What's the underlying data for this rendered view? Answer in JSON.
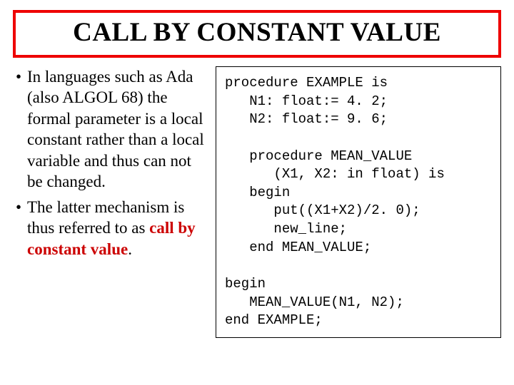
{
  "title": "CALL BY CONSTANT VALUE",
  "bullets": [
    {
      "pre": "In languages such as Ada (also ALGOL 68) the formal parameter is a local constant rather than a local variable and thus can not be changed.",
      "em": "",
      "post": ""
    },
    {
      "pre": "The latter mechanism is thus referred to as ",
      "em": "call by constant value",
      "post": "."
    }
  ],
  "code": {
    "l1": "procedure EXAMPLE is",
    "l2": "   N1: float:= 4. 2;",
    "l3": "   N2: float:= 9. 6;",
    "l4": "",
    "l5": "   procedure MEAN_VALUE",
    "l6": "      (X1, X2: in float) is",
    "l7": "   begin",
    "l8": "      put((X1+X2)/2. 0);",
    "l9": "      new_line;",
    "l10": "   end MEAN_VALUE;",
    "l11": "",
    "l12": "begin",
    "l13": "   MEAN_VALUE(N1, N2);",
    "l14": "end EXAMPLE;"
  }
}
